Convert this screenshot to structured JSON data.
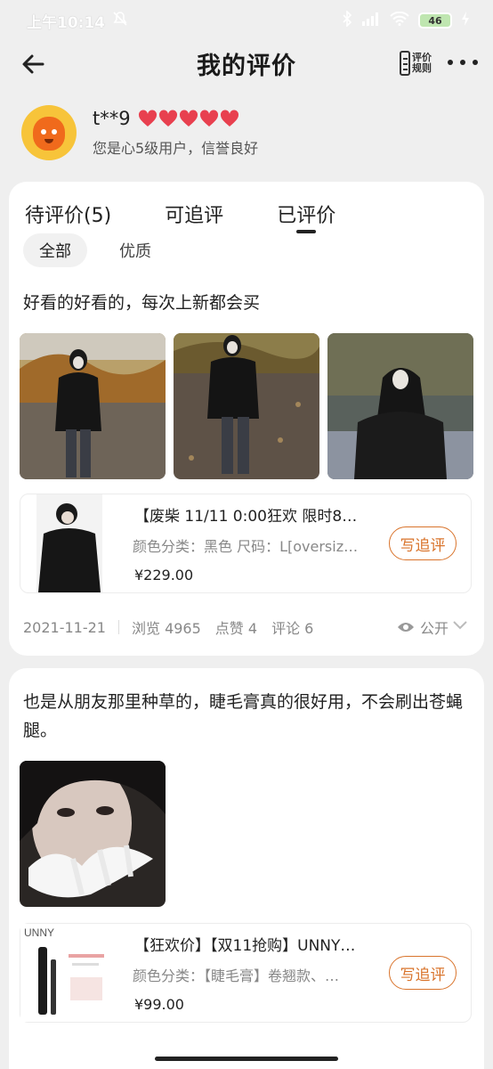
{
  "status_bar": {
    "time": "上午10:14",
    "battery": "46"
  },
  "header": {
    "title": "我的评价",
    "rules_label": "评价规则"
  },
  "user": {
    "name": "t**9",
    "level_text": "您是心5级用户，信誉良好",
    "hearts": 5
  },
  "tabs": [
    {
      "label": "待评价(5)"
    },
    {
      "label": "可追评"
    },
    {
      "label": "已评价",
      "active": true
    }
  ],
  "filters": [
    {
      "label": "全部",
      "active": true
    },
    {
      "label": "优质"
    }
  ],
  "reviews": [
    {
      "text": "好看的好看的，每次上新都会买",
      "product": {
        "title": "【废柴 11/11 0:00狂欢 限时8…",
        "spec": "颜色分类：黑色  尺码：L[oversiz…",
        "price": "¥229.00",
        "follow_label": "写追评"
      },
      "date": "2021-11-21",
      "views": "浏览 4965",
      "likes": "点赞 4",
      "comments": "评论 6",
      "visibility": "公开"
    },
    {
      "text": "也是从朋友那里种草的，睫毛膏真的很好用，不会刷出苍蝇腿。",
      "product": {
        "title": "【狂欢价】【双11抢购】UNNY…",
        "spec": "颜色分类：【睫毛膏】卷翘款、…",
        "price": "¥99.00",
        "follow_label": "写追评",
        "brand": "UNNY"
      }
    }
  ],
  "colors": {
    "accent": "#d9742c",
    "heart": "#e8404f",
    "avatar_bg": "#f7c43a"
  }
}
